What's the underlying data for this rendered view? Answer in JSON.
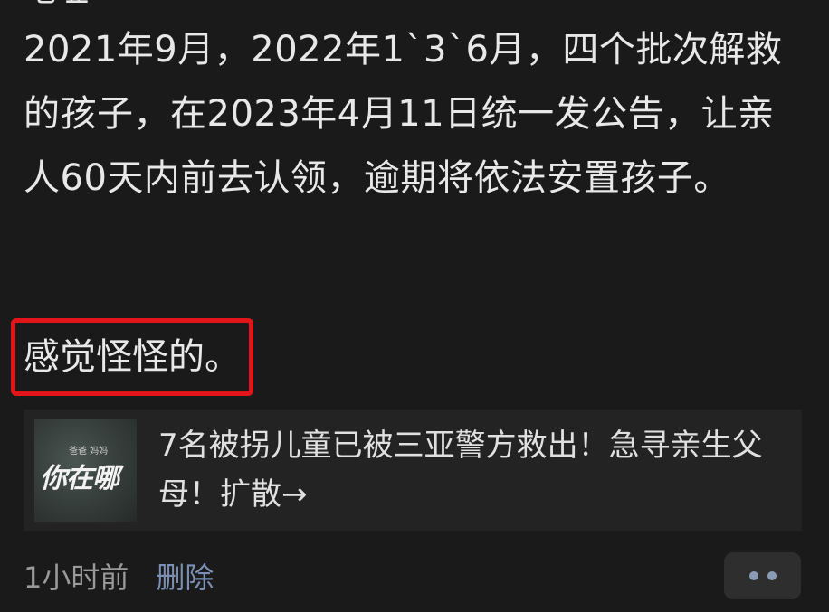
{
  "post": {
    "cut_line": "地址",
    "paragraph": "2021年9月，2022年1`3`6月，四个批次解救的孩子，在2023年4月11日统一发公告，让亲人60天内前去认领，逾期将依法安置孩子。",
    "highlight": "感觉怪怪的。"
  },
  "link_card": {
    "thumb_small": "爸爸 妈妈",
    "thumb_big": "你在哪",
    "title": "7名被拐儿童已被三亚警方救出！急寻亲生父母！扩散→"
  },
  "meta": {
    "time": "1小时前",
    "delete_label": "删除"
  },
  "colors": {
    "highlight_border": "#e3151b",
    "link_blue": "#7b8fb5",
    "background": "#1a1a1a"
  }
}
